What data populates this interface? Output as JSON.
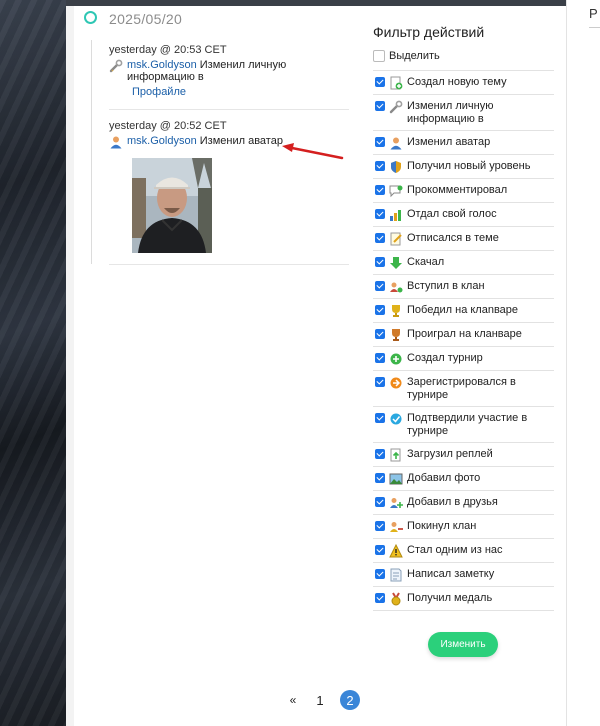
{
  "timeline": {
    "date": "2025/05/20",
    "entries": [
      {
        "time": "yesterday @ 20:53 CET",
        "user": "msk.Goldyson",
        "action": "Изменил личную информацию в",
        "link": "Профайле",
        "icon": "wrench-icon"
      },
      {
        "time": "yesterday @ 20:52 CET",
        "user": "msk.Goldyson",
        "action": "Изменил аватар",
        "icon": "person-icon"
      }
    ]
  },
  "filter": {
    "title": "Фильтр действий",
    "select_label": "Выделить",
    "items": [
      {
        "label": "Создал новую тему",
        "icon": "new-topic-icon",
        "checked": true
      },
      {
        "label": "Изменил личную информацию в",
        "icon": "wrench-icon",
        "checked": true
      },
      {
        "label": "Изменил аватар",
        "icon": "person-icon",
        "checked": true
      },
      {
        "label": "Получил новый уровень",
        "icon": "shield-icon",
        "checked": true
      },
      {
        "label": "Прокомментировал",
        "icon": "comment-icon",
        "checked": true
      },
      {
        "label": "Отдал свой голос",
        "icon": "bar-chart-icon",
        "checked": true
      },
      {
        "label": "Отписался в теме",
        "icon": "note-edit-icon",
        "checked": true
      },
      {
        "label": "Скачал",
        "icon": "download-arrow-icon",
        "checked": true
      },
      {
        "label": "Вступил в клан",
        "icon": "clan-join-icon",
        "checked": true
      },
      {
        "label": "Победил на клanваре",
        "icon": "trophy-gold-icon",
        "checked": true
      },
      {
        "label": "Проиграл на кланваре",
        "icon": "trophy-bronze-icon",
        "checked": true
      },
      {
        "label": "Создал турнир",
        "icon": "plus-circle-icon",
        "checked": true
      },
      {
        "label": "Зарегистрировался в турнире",
        "icon": "arrow-circle-icon",
        "checked": true
      },
      {
        "label": "Подтвердили участие в турнире",
        "icon": "check-circle-icon",
        "checked": true
      },
      {
        "label": "Загрузил реплей",
        "icon": "upload-replay-icon",
        "checked": true
      },
      {
        "label": "Добавил фото",
        "icon": "photo-icon",
        "checked": true
      },
      {
        "label": "Добавил в друзья",
        "icon": "add-friend-icon",
        "checked": true
      },
      {
        "label": "Покинул клан",
        "icon": "leave-clan-icon",
        "checked": true
      },
      {
        "label": "Стал одним из нас",
        "icon": "warning-icon",
        "checked": true
      },
      {
        "label": "Написал заметку",
        "icon": "paper-note-icon",
        "checked": true
      },
      {
        "label": "Получил медаль",
        "icon": "medal-icon",
        "checked": true
      }
    ],
    "apply_label": "Изменить"
  },
  "pagination": {
    "prev": "«",
    "pages": [
      "1",
      "2"
    ],
    "current": "2"
  },
  "side_peek": "Р"
}
